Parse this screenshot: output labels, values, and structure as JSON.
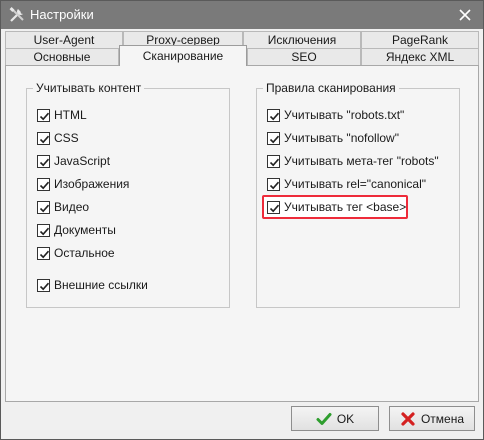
{
  "window": {
    "title": "Настройки"
  },
  "tabs_row1": [
    {
      "label": "User-Agent"
    },
    {
      "label": "Proxy-сервер"
    },
    {
      "label": "Исключения"
    },
    {
      "label": "PageRank"
    }
  ],
  "tabs_row2": [
    {
      "label": "Основные"
    },
    {
      "label": "Сканирование",
      "active": true
    },
    {
      "label": "SEO"
    },
    {
      "label": "Яндекс XML"
    }
  ],
  "left_group": {
    "title": "Учитывать контент",
    "items": [
      {
        "label": "HTML",
        "checked": true
      },
      {
        "label": "CSS",
        "checked": true
      },
      {
        "label": "JavaScript",
        "checked": true
      },
      {
        "label": "Изображения",
        "checked": true
      },
      {
        "label": "Видео",
        "checked": true
      },
      {
        "label": "Документы",
        "checked": true
      },
      {
        "label": "Остальное",
        "checked": true
      },
      {
        "label": "Внешние ссылки",
        "checked": true
      }
    ]
  },
  "right_group": {
    "title": "Правила сканирования",
    "items": [
      {
        "label": "Учитывать \"robots.txt\"",
        "checked": true
      },
      {
        "label": "Учитывать \"nofollow\"",
        "checked": true
      },
      {
        "label": "Учитывать мета-тег \"robots\"",
        "checked": true
      },
      {
        "label": "Учитывать rel=\"canonical\"",
        "checked": true
      },
      {
        "label": "Учитывать тег <base>",
        "checked": true
      }
    ]
  },
  "buttons": {
    "ok": "OK",
    "cancel": "Отмена"
  },
  "colors": {
    "highlight": "#ee2b3a",
    "titlebar": "#7a7a7a",
    "ok_check": "#2e9e2e",
    "cancel_x": "#d42020"
  }
}
